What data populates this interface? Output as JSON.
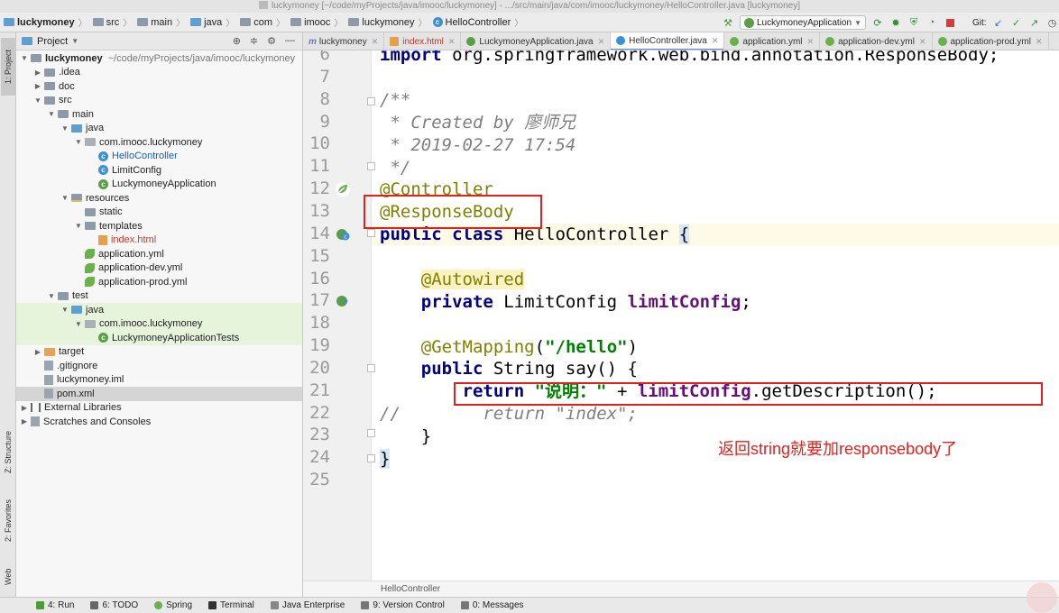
{
  "window_title": "luckymoney [~/code/myProjects/java/imooc/luckymoney] - .../src/main/java/com/imooc/luckymoney/HelloController.java [luckymoney]",
  "nav_crumbs": [
    "luckymoney",
    "src",
    "main",
    "java",
    "com",
    "imooc",
    "luckymoney",
    "HelloController"
  ],
  "run_config": "LuckymoneyApplication",
  "git_label": "Git:",
  "left_tabs": [
    "1: Project",
    "Z: Structure",
    "2: Favorites",
    "Web"
  ],
  "project_panel": {
    "title": "Project",
    "tree": [
      {
        "label": "luckymoney",
        "extra": "~/code/myProjects/java/imooc/luckymoney",
        "depth": 0,
        "icon": "folder-icon",
        "arrow": "open",
        "bold": true
      },
      {
        "label": ".idea",
        "depth": 1,
        "icon": "folder-icon",
        "arrow": "closed"
      },
      {
        "label": "doc",
        "depth": 1,
        "icon": "folder-icon",
        "arrow": "closed"
      },
      {
        "label": "src",
        "depth": 1,
        "icon": "folder-icon",
        "arrow": "open"
      },
      {
        "label": "main",
        "depth": 2,
        "icon": "folder-icon",
        "arrow": "open"
      },
      {
        "label": "java",
        "depth": 3,
        "icon": "source-folder-icon",
        "arrow": "open"
      },
      {
        "label": "com.imooc.luckymoney",
        "depth": 4,
        "icon": "package-icon",
        "arrow": "open"
      },
      {
        "label": "HelloController",
        "depth": 5,
        "icon": "class-icon",
        "arrow": "none",
        "color": "blue"
      },
      {
        "label": "LimitConfig",
        "depth": 5,
        "icon": "class-icon",
        "arrow": "none"
      },
      {
        "label": "LuckymoneyApplication",
        "depth": 5,
        "icon": "spring-class-icon",
        "arrow": "none"
      },
      {
        "label": "resources",
        "depth": 3,
        "icon": "resources-folder-icon",
        "arrow": "open"
      },
      {
        "label": "static",
        "depth": 4,
        "icon": "folder-icon",
        "arrow": "none"
      },
      {
        "label": "templates",
        "depth": 4,
        "icon": "folder-icon",
        "arrow": "open"
      },
      {
        "label": "index.html",
        "depth": 5,
        "icon": "html-file-icon",
        "arrow": "none",
        "color": "red"
      },
      {
        "label": "application.yml",
        "depth": 4,
        "icon": "spring-yml-icon",
        "arrow": "none"
      },
      {
        "label": "application-dev.yml",
        "depth": 4,
        "icon": "spring-yml-icon",
        "arrow": "none"
      },
      {
        "label": "application-prod.yml",
        "depth": 4,
        "icon": "spring-yml-icon",
        "arrow": "none"
      },
      {
        "label": "test",
        "depth": 2,
        "icon": "folder-icon",
        "arrow": "open"
      },
      {
        "label": "java",
        "depth": 3,
        "icon": "test-folder-icon",
        "arrow": "open",
        "green": true
      },
      {
        "label": "com.imooc.luckymoney",
        "depth": 4,
        "icon": "package-icon",
        "arrow": "open",
        "green": true
      },
      {
        "label": "LuckymoneyApplicationTests",
        "depth": 5,
        "icon": "spring-class-icon",
        "arrow": "none",
        "green": true
      },
      {
        "label": "target",
        "depth": 1,
        "icon": "excluded-folder-icon",
        "arrow": "closed"
      },
      {
        "label": ".gitignore",
        "depth": 1,
        "icon": "file-icon",
        "arrow": "none"
      },
      {
        "label": "luckymoney.iml",
        "depth": 1,
        "icon": "iml-file-icon",
        "arrow": "none"
      },
      {
        "label": "pom.xml",
        "depth": 1,
        "icon": "maven-file-icon",
        "arrow": "none",
        "selected": true
      },
      {
        "label": "External Libraries",
        "depth": 0,
        "icon": "library-icon",
        "arrow": "closed"
      },
      {
        "label": "Scratches and Consoles",
        "depth": 0,
        "icon": "scratch-icon",
        "arrow": "closed"
      }
    ]
  },
  "editor_tabs": [
    {
      "label": "luckymoney",
      "icon": "maven-icon"
    },
    {
      "label": "index.html",
      "icon": "html-icon",
      "color": "red"
    },
    {
      "label": "LuckymoneyApplication.java",
      "icon": "spring-class-icon"
    },
    {
      "label": "HelloController.java",
      "icon": "class-icon",
      "active": true
    },
    {
      "label": "application.yml",
      "icon": "spring-yml-icon"
    },
    {
      "label": "application-dev.yml",
      "icon": "spring-yml-icon"
    },
    {
      "label": "application-prod.yml",
      "icon": "spring-yml-icon"
    }
  ],
  "line_numbers": [
    "6",
    "7",
    "8",
    "9",
    "10",
    "11",
    "12",
    "13",
    "14",
    "15",
    "16",
    "17",
    "18",
    "19",
    "20",
    "21",
    "22",
    "23",
    "24",
    "25"
  ],
  "code": {
    "l6_kw": "import",
    "l6_rest": " org.springframework.web.bind.annotation.ResponseBody;",
    "l8": "/**",
    "l9": " * Created by 廖师兄",
    "l10": " * 2019-02-27 17:54",
    "l11": " */",
    "l12": "@Controller",
    "l13": "@ResponseBody",
    "l14_kw1": "public",
    "l14_kw2": "class",
    "l14_name": " HelloController ",
    "l14_brace": "{",
    "l16": "@Autowired",
    "l17_kw": "private",
    "l17_type": " LimitConfig ",
    "l17_field": "limitConfig",
    "l17_end": ";",
    "l19_an": "@GetMapping",
    "l19_open": "(",
    "l19_str": "\"/hello\"",
    "l19_close": ")",
    "l20_kw": "public",
    "l20_rest": " String say() {",
    "l21_kw": "return",
    "l21_str": "\"说明：\"",
    "l21_plus": " + ",
    "l21_field": "limitConfig",
    "l21_rest": ".getDescription();",
    "l22": "//        return \"index\";",
    "l23": "}",
    "l24": "}"
  },
  "annotation_note": "返回string就要加responsebody了",
  "editor_breadcrumb": "HelloController",
  "bottom_tools": [
    "4: Run",
    "6: TODO",
    "Spring",
    "Terminal",
    "Java Enterprise",
    "9: Version Control",
    "0: Messages"
  ],
  "colors": {
    "annotation_red": "#e0221e",
    "keyword": "#000080",
    "string": "#008000",
    "field": "#660e7a"
  }
}
